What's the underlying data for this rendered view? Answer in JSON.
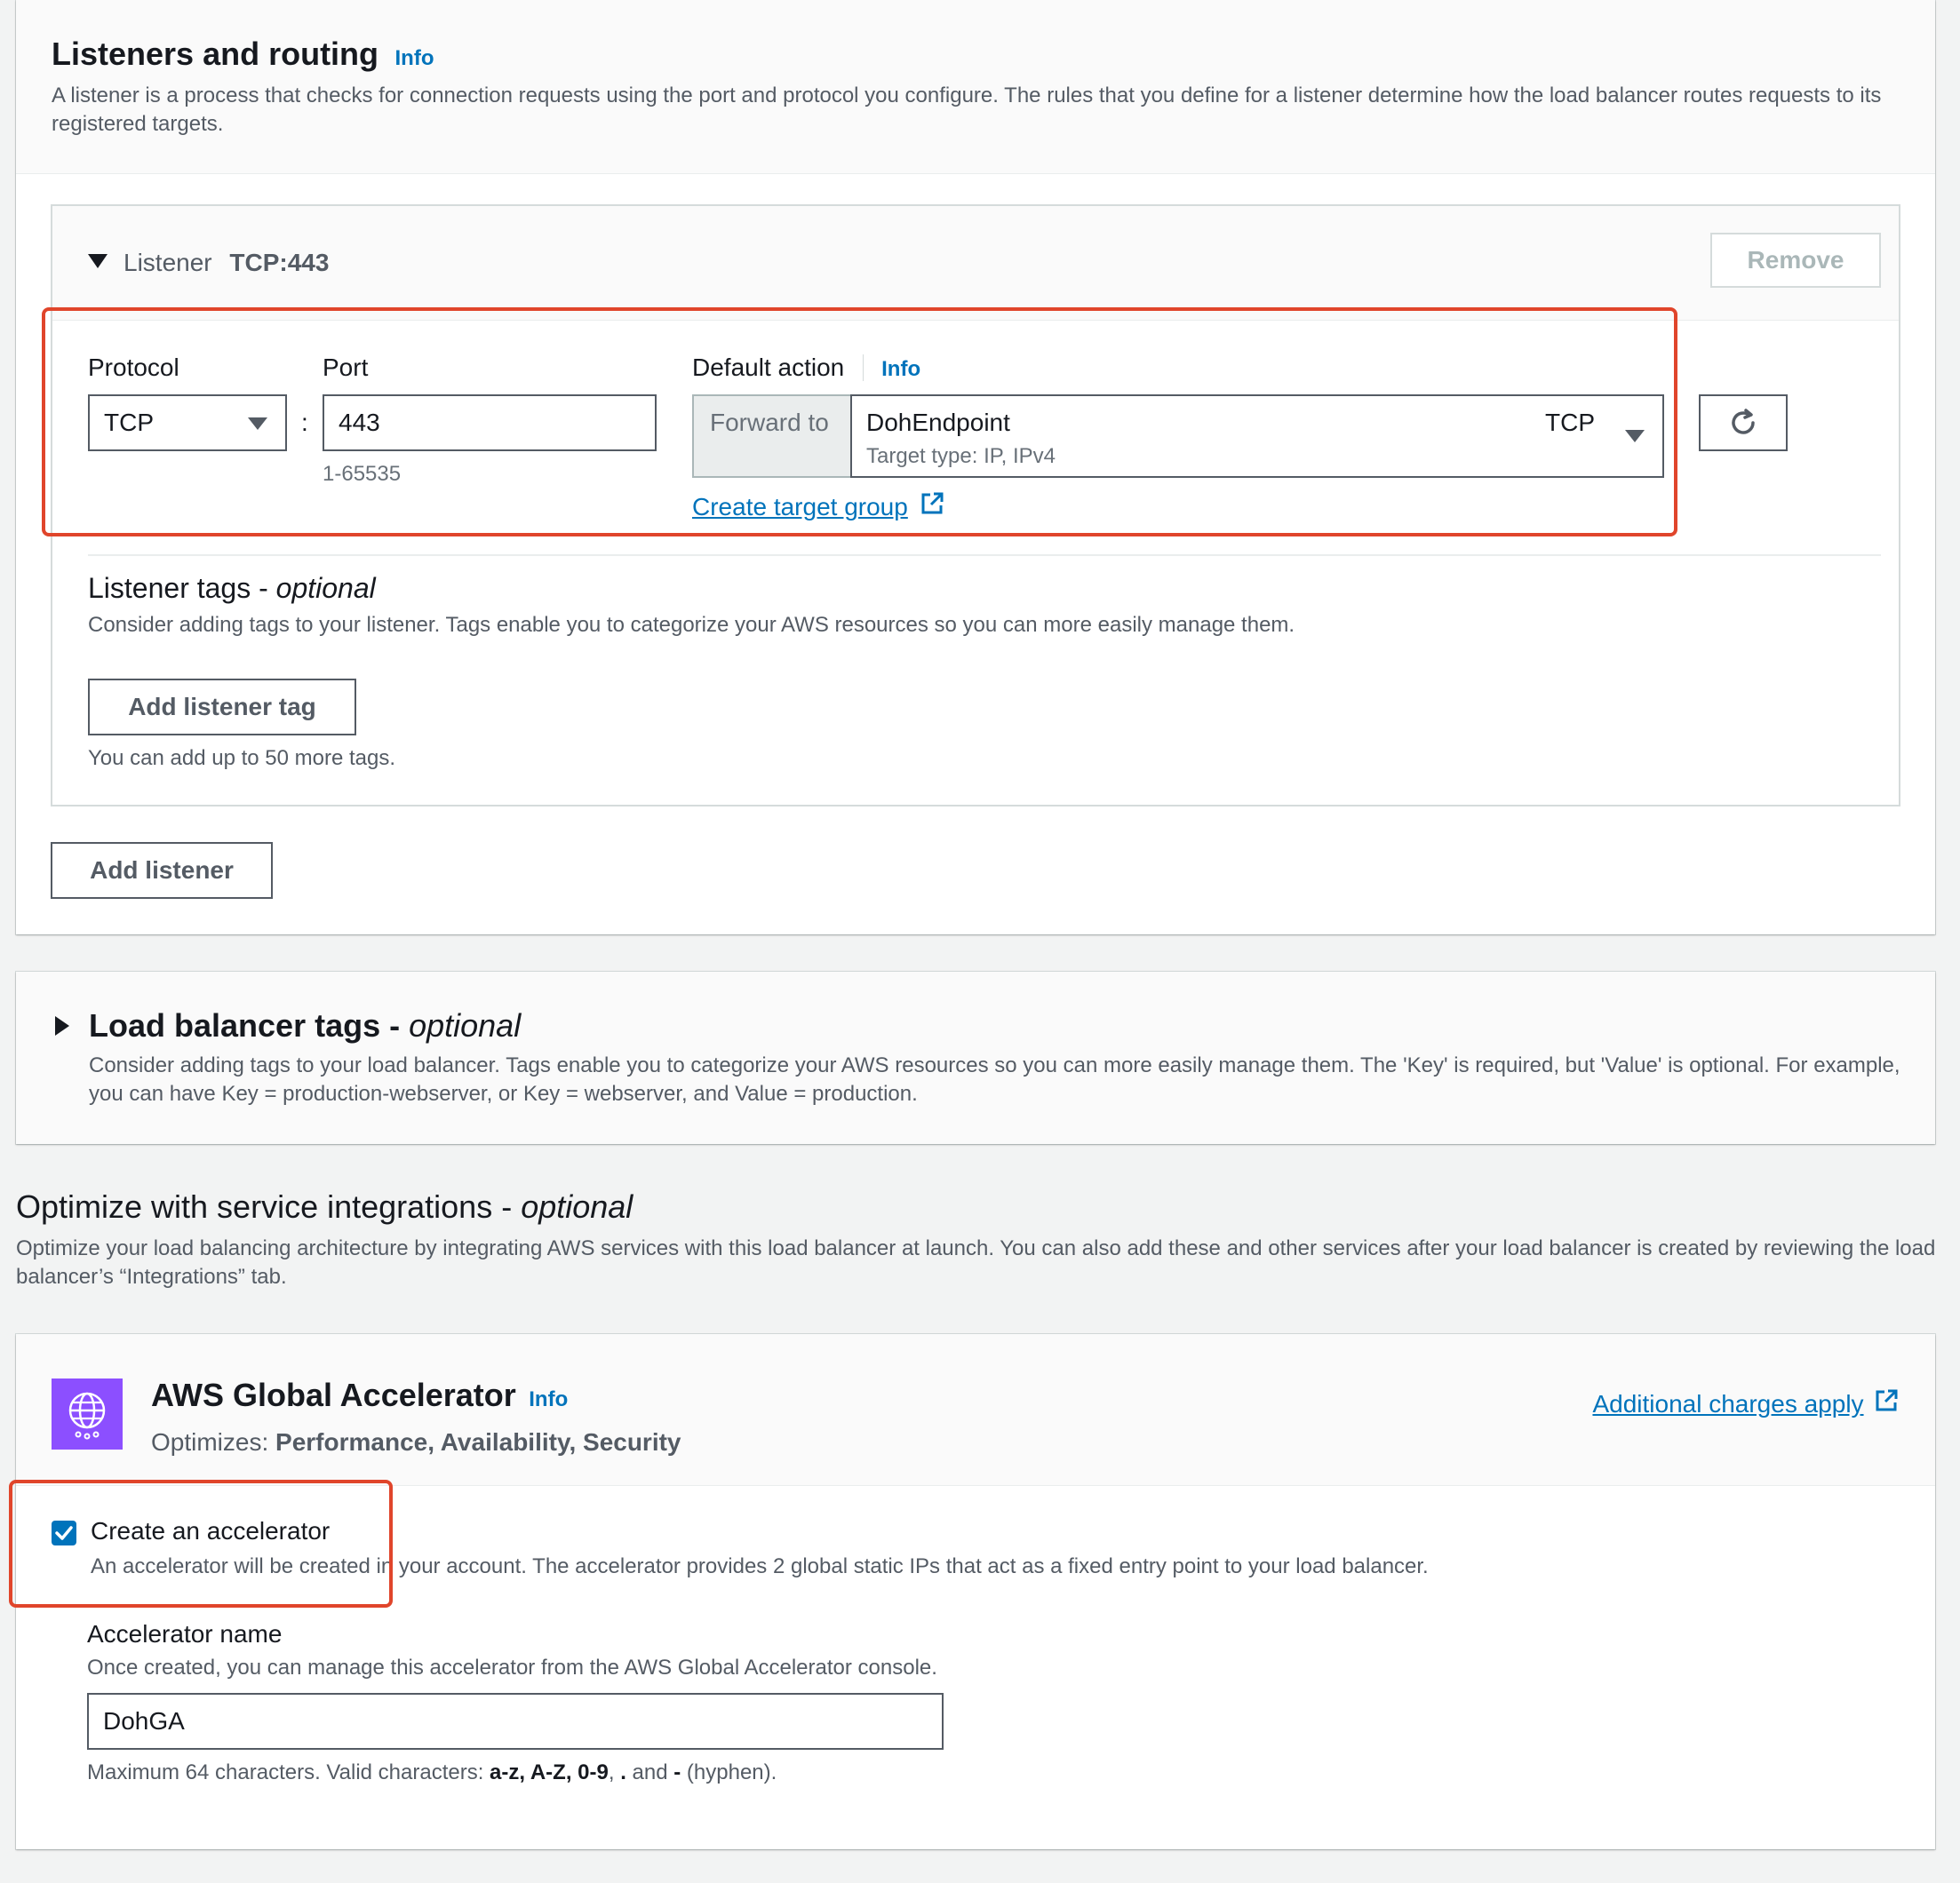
{
  "listeners": {
    "title": "Listeners and routing",
    "info": "Info",
    "description": "A listener is a process that checks for connection requests using the port and protocol you configure. The rules that you define for a listener determine how the load balancer routes requests to its registered targets.",
    "listener": {
      "heading_label": "Listener",
      "heading_value": "TCP:443",
      "remove_label": "Remove",
      "protocol_label": "Protocol",
      "protocol_value": "TCP",
      "separator": ":",
      "port_label": "Port",
      "port_value": "443",
      "port_hint": "1-65535",
      "default_action_label": "Default action",
      "default_action_info": "Info",
      "forward_to_label": "Forward to",
      "target_group_name": "DohEndpoint",
      "target_group_protocol": "TCP",
      "target_group_type": "Target type: IP, IPv4",
      "create_target_group_label": "Create target group",
      "tags_title": "Listener tags - ",
      "tags_title_optional": "optional",
      "tags_description": "Consider adding tags to your listener. Tags enable you to categorize your AWS resources so you can more easily manage them.",
      "add_tag_label": "Add listener tag",
      "tag_limit_hint": "You can add up to 50 more tags."
    },
    "add_listener_label": "Add listener"
  },
  "lb_tags": {
    "title": "Load balancer tags - ",
    "title_optional": "optional",
    "description": "Consider adding tags to your load balancer. Tags enable you to categorize your AWS resources so you can more easily manage them. The 'Key' is required, but 'Value' is optional. For example, you can have Key = production-webserver, or Key = webserver, and Value = production."
  },
  "integrations": {
    "title": "Optimize with service integrations - ",
    "title_optional": "optional",
    "description": "Optimize your load balancing architecture by integrating AWS services with this load balancer at launch. You can also add these and other services after your load balancer is created by reviewing the load balancer’s “Integrations” tab."
  },
  "global_accelerator": {
    "title": "AWS Global Accelerator",
    "info": "Info",
    "optimizes_label": "Optimizes:",
    "optimizes_value": "Performance, Availability, Security",
    "charges_link": "Additional charges apply",
    "create_checkbox_label": "Create an accelerator",
    "create_checkbox_checked": true,
    "create_description": "An accelerator will be created in your account. The accelerator provides 2 global static IPs that act as a fixed entry point to your load balancer.",
    "name_label": "Accelerator name",
    "name_description": "Once created, you can manage this accelerator from the AWS Global Accelerator console.",
    "name_value": "DohGA",
    "constraint_prefix": "Maximum 64 characters. Valid characters: ",
    "constraint_chars": "a-z, A-Z, 0-9",
    "constraint_sep": ", ",
    "constraint_dot": ".",
    "constraint_and": " and ",
    "constraint_dash": "-",
    "constraint_suffix": " (hyphen).",
    "icon_color": "#8c4fff"
  },
  "colors": {
    "link": "#0073bb",
    "highlight": "#e0452b",
    "checkbox": "#0073bb"
  }
}
